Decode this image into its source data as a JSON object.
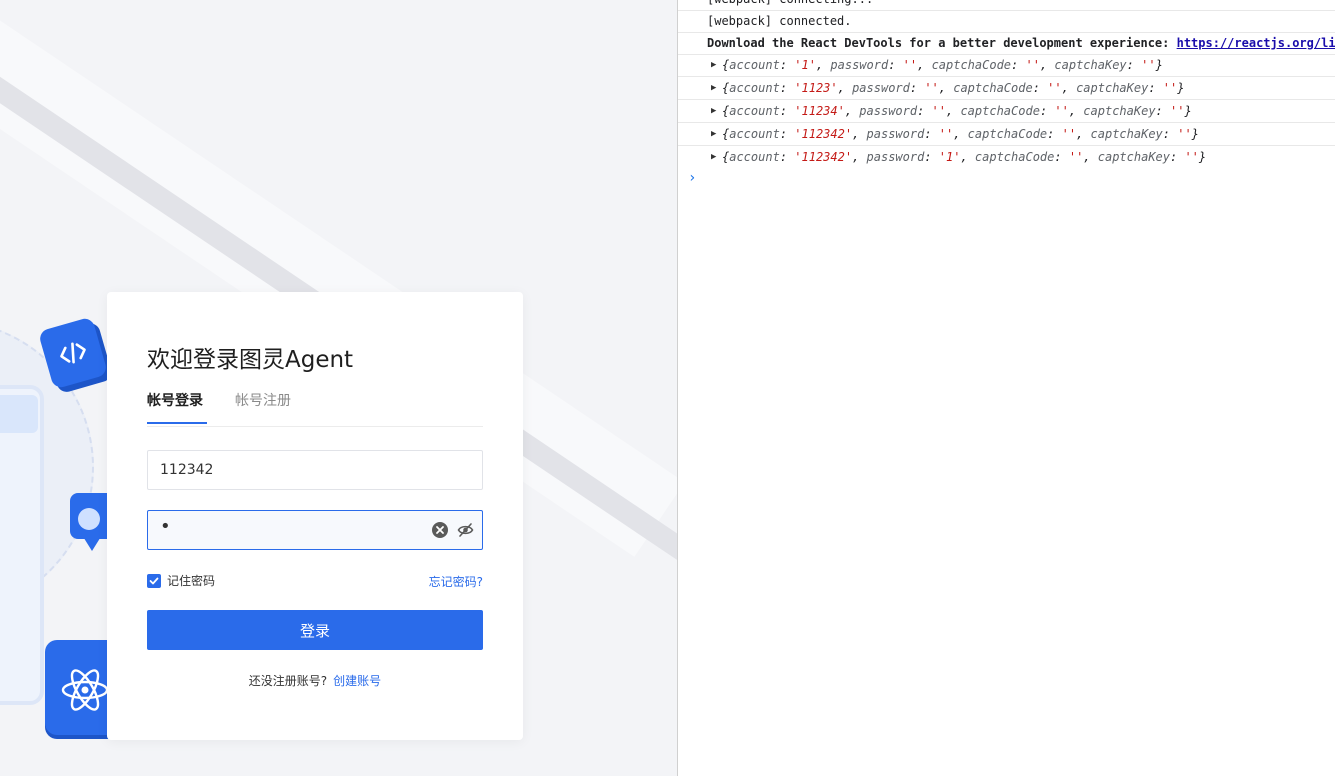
{
  "login": {
    "title": "欢迎登录图灵Agent",
    "tabs": [
      {
        "label": "帐号登录",
        "active": true
      },
      {
        "label": "帐号注册",
        "active": false
      }
    ],
    "account_value": "112342",
    "password_value": "•",
    "remember_label": "记住密码",
    "remember_checked": true,
    "forgot_label": "忘记密码?",
    "submit_label": "登录",
    "no_account_text": "还没注册账号?",
    "create_account_label": "创建账号"
  },
  "colors": {
    "primary": "#2a6bea",
    "console_string": "#c41a16",
    "console_link": "#1a0dab"
  },
  "console": {
    "lines": [
      {
        "text": "[webpack] connecting..."
      },
      {
        "text": "[webpack] connected."
      },
      {
        "text": "Download the React DevTools for a better development experience: ",
        "link": "https://reactjs.org/li"
      }
    ],
    "objects": [
      {
        "account": "'1'",
        "password": "''",
        "captchaCode": "''",
        "captchaKey": "''"
      },
      {
        "account": "'1123'",
        "password": "''",
        "captchaCode": "''",
        "captchaKey": "''"
      },
      {
        "account": "'11234'",
        "password": "''",
        "captchaCode": "''",
        "captchaKey": "''"
      },
      {
        "account": "'112342'",
        "password": "''",
        "captchaCode": "''",
        "captchaKey": "''"
      },
      {
        "account": "'112342'",
        "password": "'1'",
        "captchaCode": "''",
        "captchaKey": "''"
      }
    ],
    "prompt_symbol": "›"
  }
}
